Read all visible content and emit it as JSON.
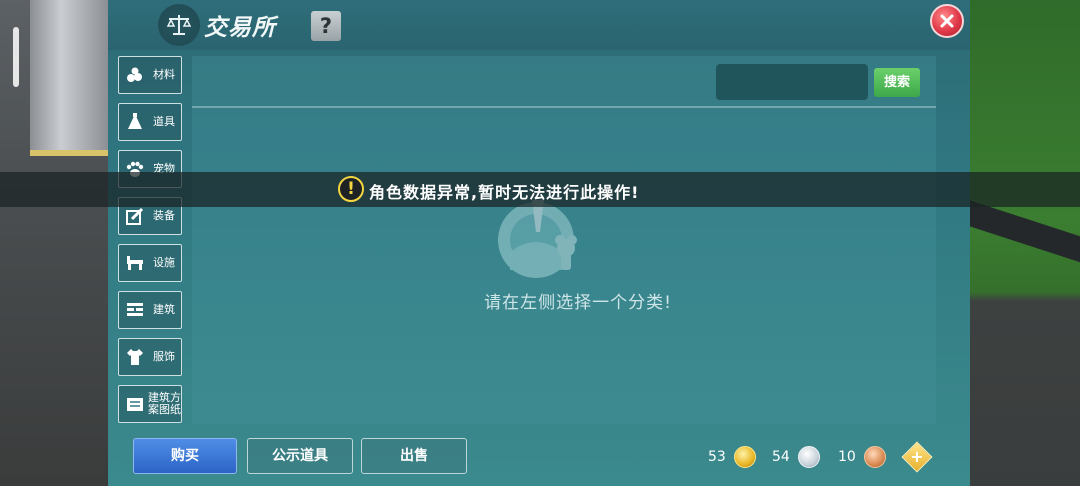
{
  "window": {
    "title": "交易所",
    "help_label": "?",
    "close_icon": "close-icon"
  },
  "categories": [
    {
      "label": "材料",
      "icon": "materials-icon"
    },
    {
      "label": "道具",
      "icon": "item-icon"
    },
    {
      "label": "宠物",
      "icon": "paw-icon"
    },
    {
      "label": "装备",
      "icon": "equipment-icon"
    },
    {
      "label": "设施",
      "icon": "facility-icon"
    },
    {
      "label": "建筑",
      "icon": "building-icon"
    },
    {
      "label": "服饰",
      "icon": "clothing-icon"
    },
    {
      "label": "建筑方案图纸",
      "line1": "建筑方",
      "line2": "案图纸",
      "icon": "blueprint-icon"
    }
  ],
  "search": {
    "value": "",
    "placeholder": "",
    "button_label": "搜索"
  },
  "content": {
    "empty_hint": "请在左侧选择一个分类!"
  },
  "toast": {
    "icon": "warning-icon",
    "text": "角色数据异常,暂时无法进行此操作!"
  },
  "tabs": {
    "buy": "购买",
    "public": "公示道具",
    "sell": "出售"
  },
  "currency": {
    "gold": "53",
    "silver": "54",
    "copper": "10",
    "add_icon": "plus-icon"
  },
  "colors": {
    "panel": "#2f7580",
    "accent_green": "#3da84a",
    "accent_blue": "#2c64c7",
    "warning": "#f3d640",
    "close_red": "#e0394a"
  }
}
